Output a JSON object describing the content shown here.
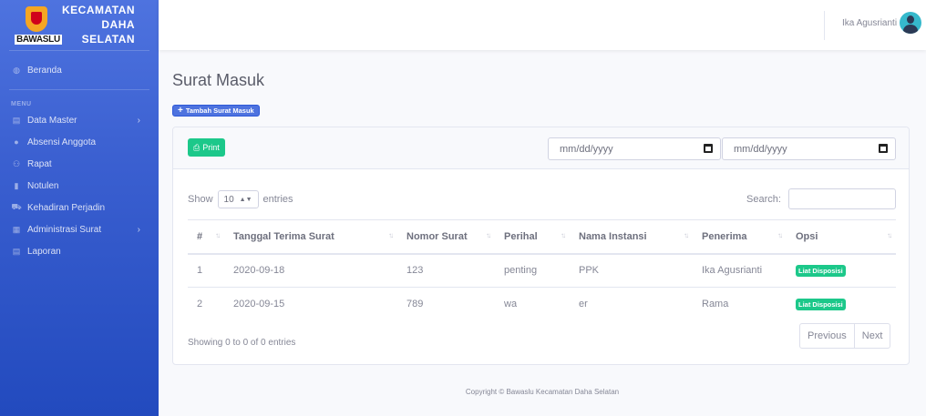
{
  "brand": {
    "logo_text": "BAWASLU",
    "line1": "KECAMATAN",
    "line2": "DAHA",
    "line3": "SELATAN"
  },
  "sidebar": {
    "dashboard": {
      "label": "Beranda",
      "icon": "dashboard-icon"
    },
    "heading": "MENU",
    "items": [
      {
        "label": "Data Master",
        "icon": "folder-icon",
        "has_chevron": true
      },
      {
        "label": "Absensi Anggota",
        "icon": "user-check-icon",
        "has_chevron": false
      },
      {
        "label": "Rapat",
        "icon": "users-icon",
        "has_chevron": false
      },
      {
        "label": "Notulen",
        "icon": "note-icon",
        "has_chevron": false
      },
      {
        "label": "Kehadiran Perjadin",
        "icon": "car-icon",
        "has_chevron": false
      },
      {
        "label": "Administrasi Surat",
        "icon": "mail-icon",
        "has_chevron": true
      },
      {
        "label": "Laporan",
        "icon": "report-icon",
        "has_chevron": false
      }
    ],
    "chevron": "›"
  },
  "topbar": {
    "user_name": "Ika Agusrianti"
  },
  "main": {
    "title": "Surat Masuk",
    "add_button": "Tambah Surat Masuk",
    "print_button": "Print",
    "date_from_placeholder": "mm/dd/yyyy",
    "date_to_placeholder": "mm/dd/yyyy",
    "show_label": "Show",
    "entries_value": "10",
    "entries_label": "entries",
    "search_label": "Search:",
    "columns": [
      "#",
      "Tanggal Terima Surat",
      "Nomor Surat",
      "Perihal",
      "Nama Instansi",
      "Penerima",
      "Opsi"
    ],
    "rows": [
      {
        "no": "1",
        "tanggal": "2020-09-18",
        "nomor": "123",
        "perihal": "penting",
        "instansi": "PPK",
        "penerima": "Ika Agusrianti",
        "opsi": "Liat Disposisi"
      },
      {
        "no": "2",
        "tanggal": "2020-09-15",
        "nomor": "789",
        "perihal": "wa",
        "instansi": "er",
        "penerima": "Rama",
        "opsi": "Liat Disposisi"
      }
    ],
    "info": "Showing 0 to 0 of 0 entries",
    "prev": "Previous",
    "next": "Next"
  },
  "footer": "Copyright © Bawaslu Kecamatan Daha Selatan"
}
